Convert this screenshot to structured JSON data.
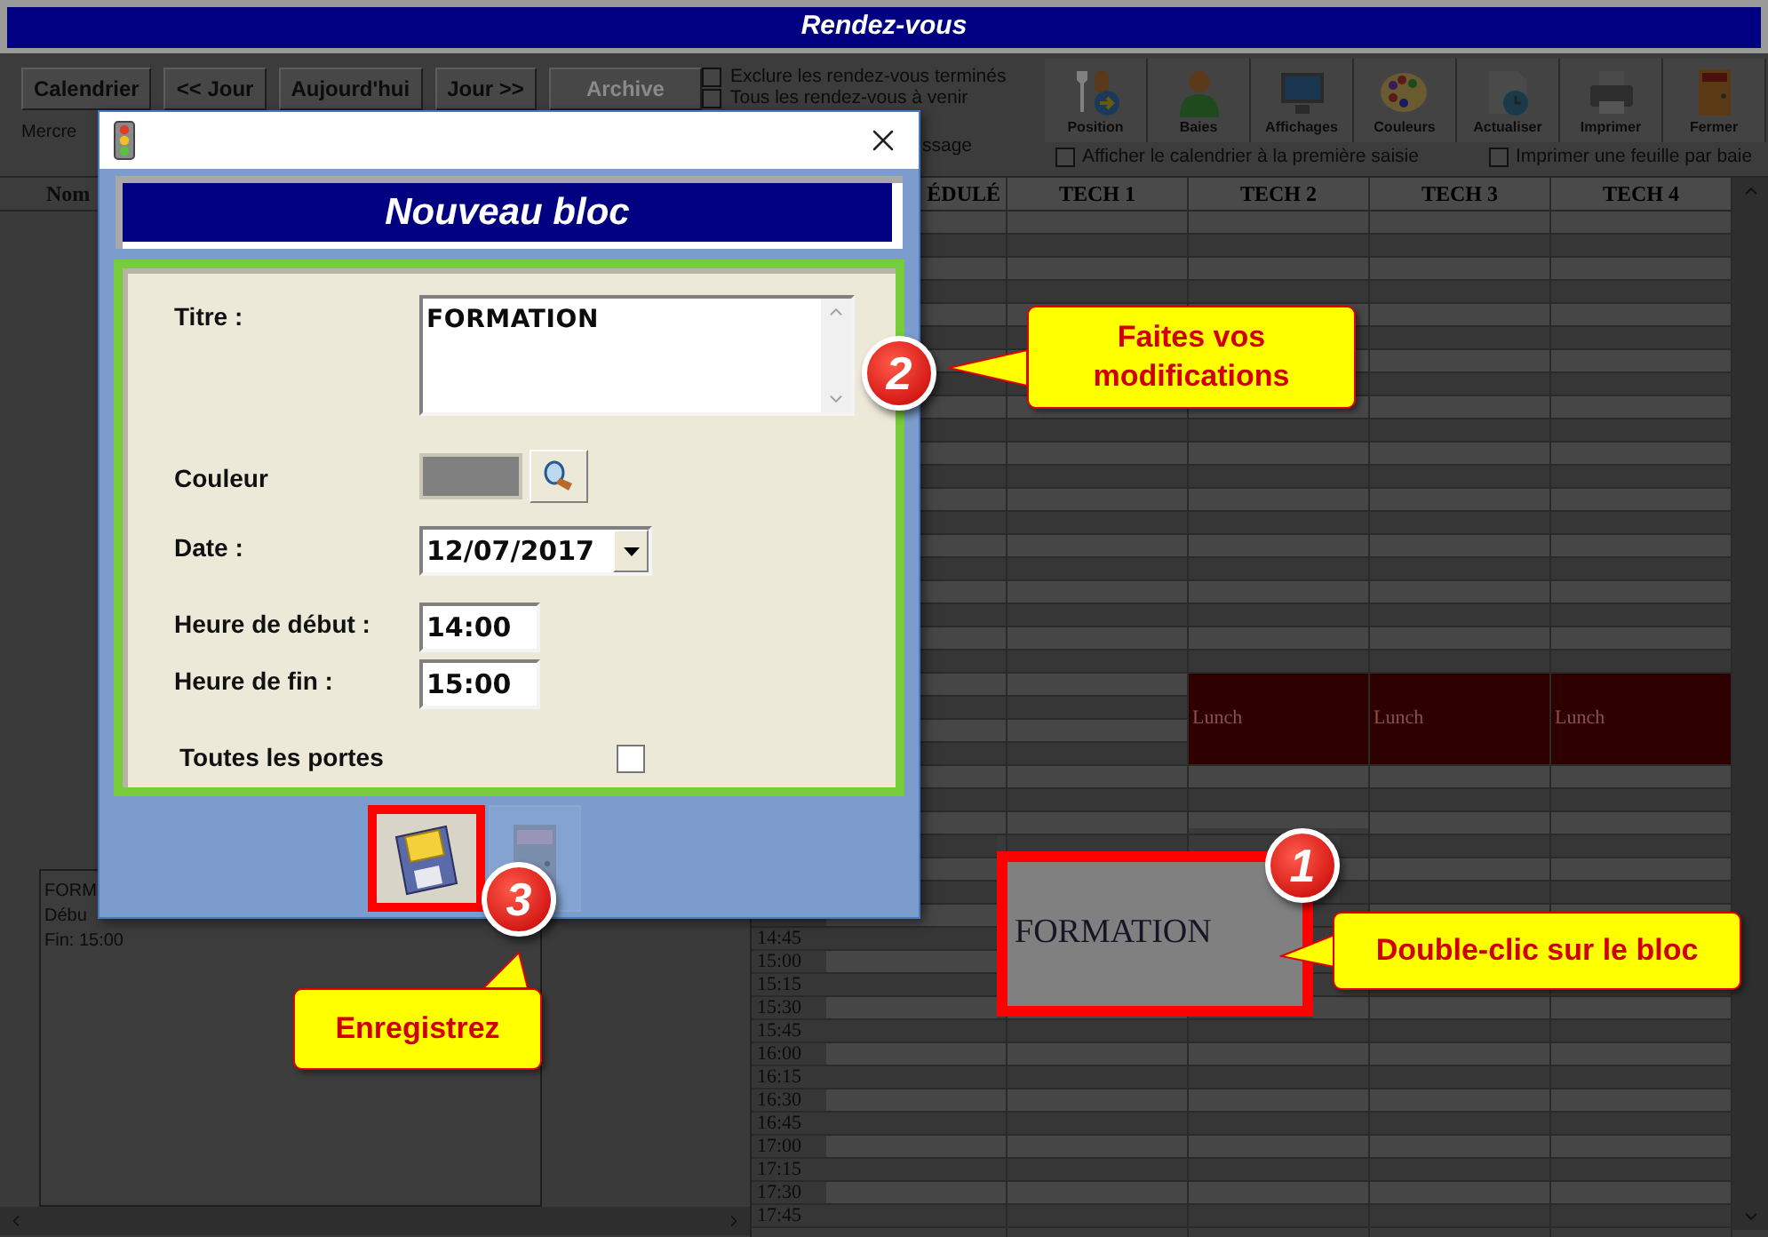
{
  "window": {
    "title": "Rendez-vous"
  },
  "nav_buttons": [
    {
      "label": "Calendrier",
      "disabled": false
    },
    {
      "label": "<< Jour",
      "disabled": false
    },
    {
      "label": "Aujourd'hui",
      "disabled": false
    },
    {
      "label": "Jour >>",
      "disabled": false
    },
    {
      "label": "Archive",
      "disabled": true
    }
  ],
  "date_label": "Mercre",
  "filters": [
    {
      "label": "Exclure les rendez-vous terminés",
      "checked": false
    },
    {
      "label": "Tous les rendez-vous à venir",
      "checked": false
    }
  ],
  "filter_tail": "ssage",
  "toolbar": [
    {
      "kind": "position",
      "label": "Position"
    },
    {
      "kind": "person",
      "label": "Baies"
    },
    {
      "kind": "monitor",
      "label": "Affichages"
    },
    {
      "kind": "palette",
      "label": "Couleurs"
    },
    {
      "kind": "refresh",
      "label": "Actualiser"
    },
    {
      "kind": "printer",
      "label": "Imprimer"
    },
    {
      "kind": "door",
      "label": "Fermer"
    }
  ],
  "options": [
    {
      "label": "Afficher le calendrier à la première saisie",
      "checked": false
    },
    {
      "label": "Imprimer une feuille par baie",
      "checked": false
    }
  ],
  "grid": {
    "name_header": "Nom",
    "columns": [
      {
        "header": "ÉDULÉ"
      },
      {
        "header": "TECH 1"
      },
      {
        "header": "TECH 2",
        "blocks": [
          {
            "kind": "lunch",
            "label": "Lunch",
            "color": "#2e0000"
          }
        ]
      },
      {
        "header": "TECH 3",
        "blocks": [
          {
            "kind": "lunch",
            "label": "Lunch",
            "color": "#2e0000"
          }
        ]
      },
      {
        "header": "TECH 4",
        "blocks": [
          {
            "kind": "lunch",
            "label": "Lunch",
            "color": "#2e0000"
          }
        ]
      }
    ],
    "times": [
      "14:45",
      "15:00",
      "15:15",
      "15:30",
      "15:45",
      "16:00",
      "16:15",
      "16:30",
      "16:45",
      "17:00",
      "17:15",
      "17:30",
      "17:45"
    ]
  },
  "summary": {
    "lines": [
      "FORM",
      "Débu",
      "Fin: 15:00"
    ]
  },
  "appointment": {
    "label": "FORMATION",
    "color": "#808080"
  },
  "dialog": {
    "title": "Nouveau bloc",
    "fields": [
      {
        "kind": "textarea",
        "label": "Titre :",
        "value": "FORMATION"
      },
      {
        "kind": "color",
        "label": "Couleur",
        "color": "#808080"
      },
      {
        "kind": "date",
        "label": "Date :",
        "value": "12/07/2017"
      },
      {
        "kind": "time",
        "label": "Heure de début :",
        "value": "14:00"
      },
      {
        "kind": "time",
        "label": "Heure de fin :",
        "value": "15:00"
      },
      {
        "kind": "checkbox",
        "label": "Toutes les portes",
        "checked": false
      }
    ],
    "buttons": [
      {
        "kind": "save",
        "disabled": false
      },
      {
        "kind": "exit",
        "disabled": true
      }
    ]
  },
  "annotations": [
    {
      "number": "1",
      "text": "Double-clic sur le bloc"
    },
    {
      "number": "2",
      "text": "Faites vos modifications"
    },
    {
      "number": "3",
      "text": "Enregistrez"
    }
  ]
}
